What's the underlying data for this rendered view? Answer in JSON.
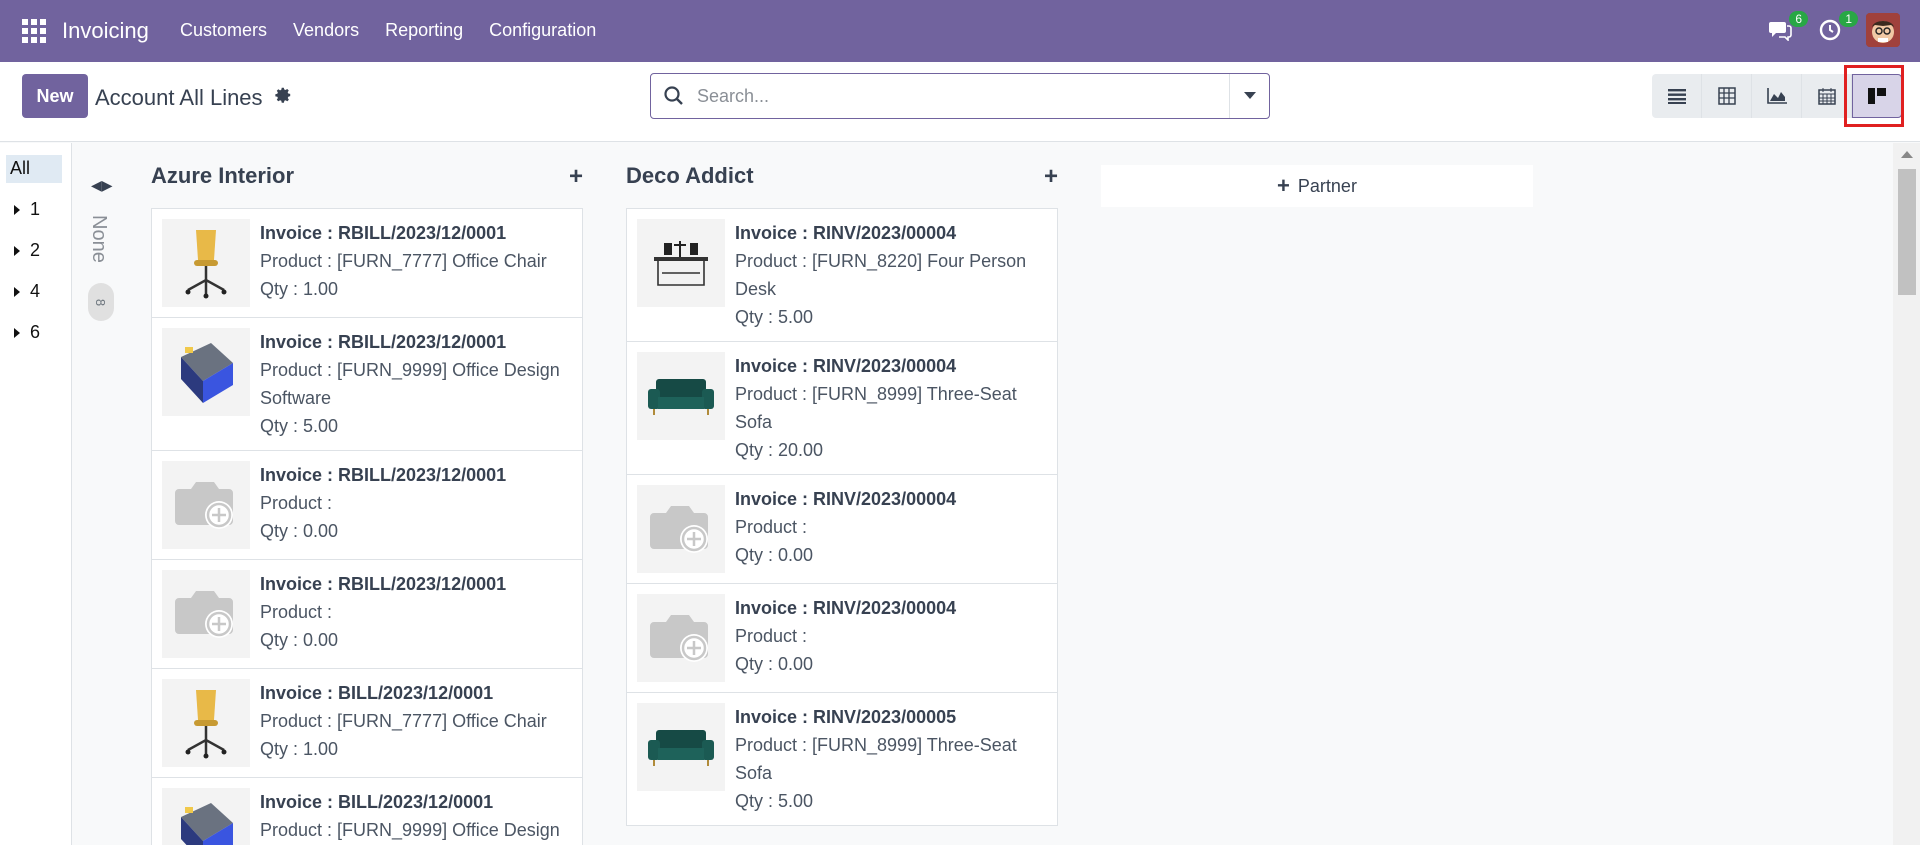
{
  "navbar": {
    "app_name": "Invoicing",
    "menu": [
      "Customers",
      "Vendors",
      "Reporting",
      "Configuration"
    ],
    "messages_count": "6",
    "activities_count": "1",
    "bg_color": "#71639e"
  },
  "control": {
    "new_label": "New",
    "title": "Account All Lines",
    "search_placeholder": "Search...",
    "views": [
      "list-view-icon",
      "pivot-view-icon",
      "graph-view-icon",
      "calendar-view-icon",
      "kanban-view-icon"
    ],
    "active_view": "kanban-view-icon"
  },
  "sidepanel": {
    "all_label": "All",
    "items": [
      "1",
      "2",
      "4",
      "6"
    ]
  },
  "folded_column": {
    "title": "None",
    "count": "8"
  },
  "columns": [
    {
      "title": "Azure Interior",
      "cards": [
        {
          "invoice": "Invoice : RBILL/2023/12/0001",
          "product": "Product : [FURN_7777] Office Chair",
          "qty": "Qty : 1.00",
          "image": "office-chair"
        },
        {
          "invoice": "Invoice : RBILL/2023/12/0001",
          "product": "Product : [FURN_9999] Office Design Software",
          "qty": "Qty : 5.00",
          "image": "software-box"
        },
        {
          "invoice": "Invoice : RBILL/2023/12/0001",
          "product": "Product :",
          "qty": "Qty : 0.00",
          "image": "camera-placeholder"
        },
        {
          "invoice": "Invoice : RBILL/2023/12/0001",
          "product": "Product :",
          "qty": "Qty : 0.00",
          "image": "camera-placeholder"
        },
        {
          "invoice": "Invoice : BILL/2023/12/0001",
          "product": "Product : [FURN_7777] Office Chair",
          "qty": "Qty : 1.00",
          "image": "office-chair"
        },
        {
          "invoice": "Invoice : BILL/2023/12/0001",
          "product": "Product : [FURN_9999] Office Design",
          "qty": "",
          "image": "software-box"
        }
      ]
    },
    {
      "title": "Deco Addict",
      "cards": [
        {
          "invoice": "Invoice : RINV/2023/00004",
          "product": "Product : [FURN_8220] Four Person Desk",
          "qty": "Qty : 5.00",
          "image": "desk"
        },
        {
          "invoice": "Invoice : RINV/2023/00004",
          "product": "Product : [FURN_8999] Three-Seat Sofa",
          "qty": "Qty : 20.00",
          "image": "sofa"
        },
        {
          "invoice": "Invoice : RINV/2023/00004",
          "product": "Product :",
          "qty": "Qty : 0.00",
          "image": "camera-placeholder"
        },
        {
          "invoice": "Invoice : RINV/2023/00004",
          "product": "Product :",
          "qty": "Qty : 0.00",
          "image": "camera-placeholder"
        },
        {
          "invoice": "Invoice : RINV/2023/00005",
          "product": "Product : [FURN_8999] Three-Seat Sofa",
          "qty": "Qty : 5.00",
          "image": "sofa"
        }
      ]
    }
  ],
  "add_column_label": "Partner"
}
